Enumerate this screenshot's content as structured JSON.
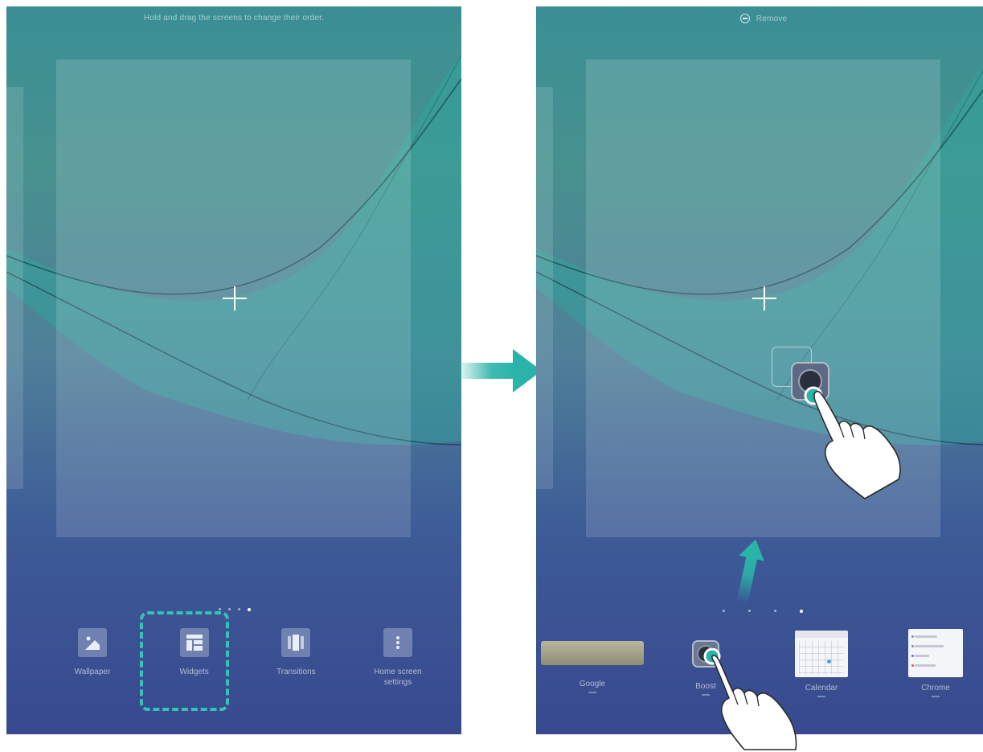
{
  "left_screen": {
    "hint_text": "Hold and drag the screens to change their order.",
    "menu_items": [
      {
        "label": "Wallpaper",
        "icon": "wallpaper-icon"
      },
      {
        "label": "Widgets",
        "icon": "widgets-icon"
      },
      {
        "label": "Transitions",
        "icon": "transitions-icon"
      },
      {
        "label": "Home screen settings",
        "icon": "settings-menu-icon"
      }
    ],
    "highlight_color": "#39c0b7"
  },
  "right_screen": {
    "remove_label": "Remove",
    "widgets": [
      {
        "label": "Google"
      },
      {
        "label": "Boost"
      },
      {
        "label": "Calendar"
      },
      {
        "label": "Chrome"
      }
    ],
    "touch_color": "#2ab3a9"
  },
  "arrow_color": "#2ab3a9"
}
